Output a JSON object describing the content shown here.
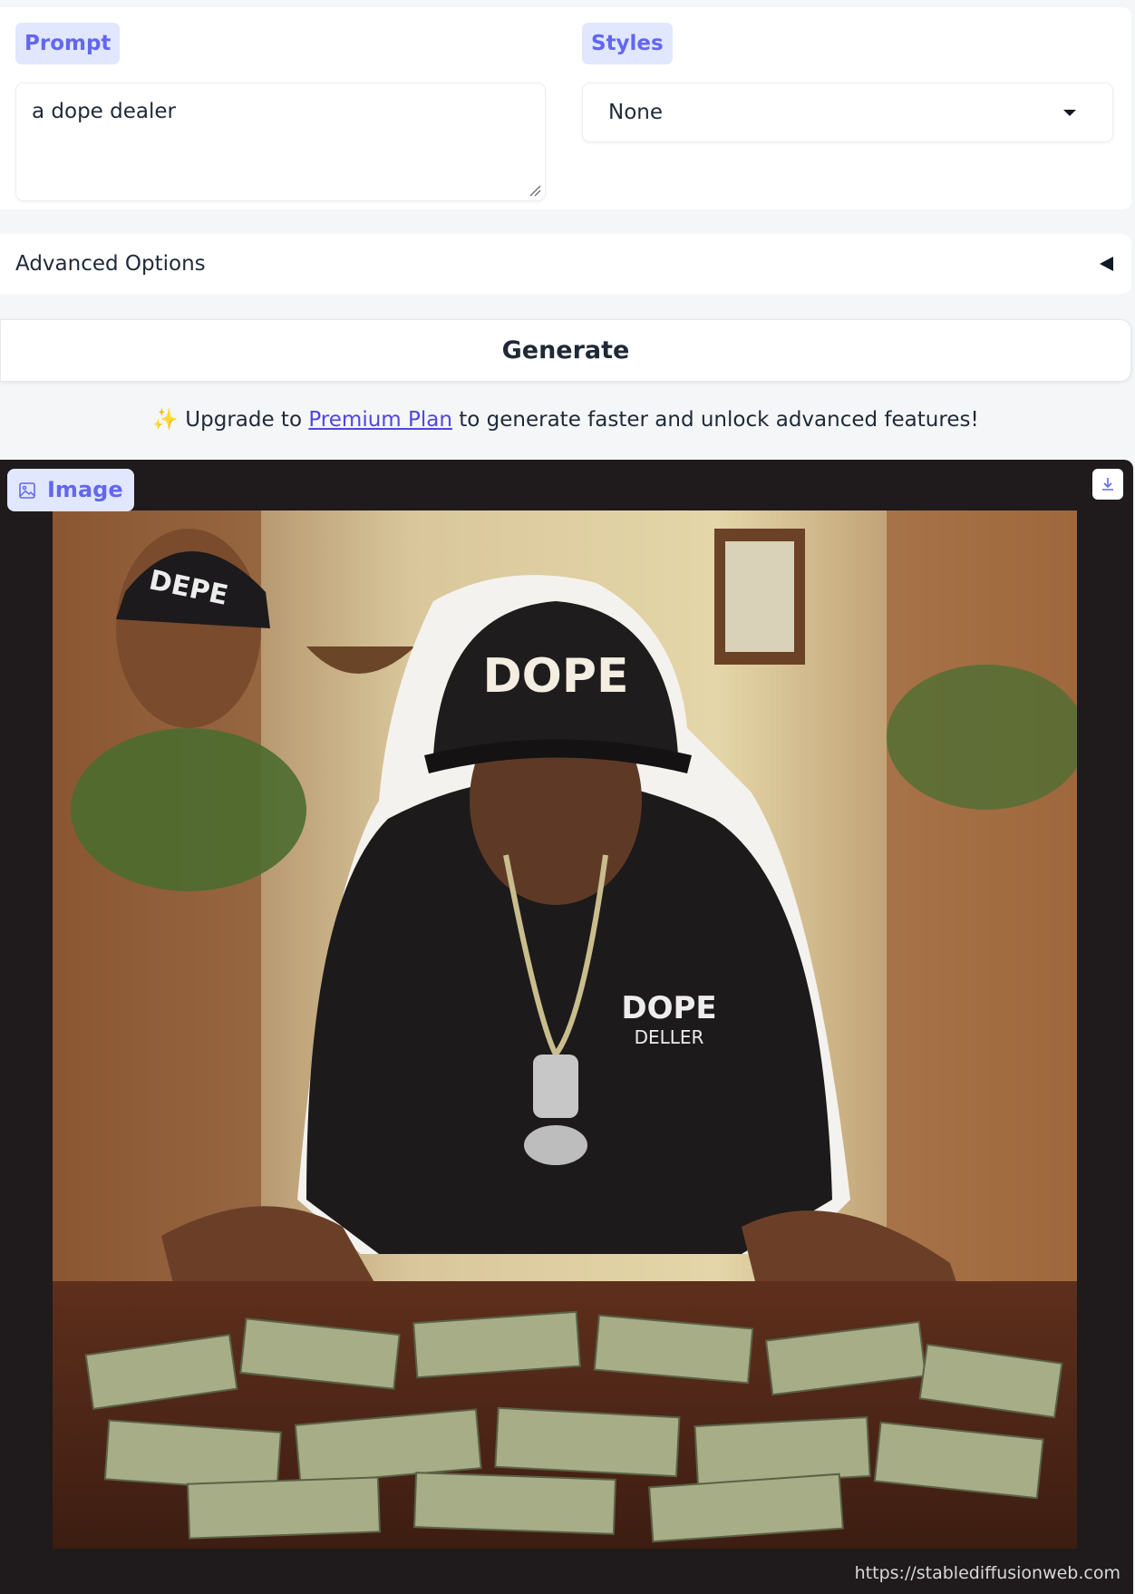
{
  "prompt": {
    "label": "Prompt",
    "value": "a dope dealer"
  },
  "styles": {
    "label": "Styles",
    "selected": "None"
  },
  "advanced_options": {
    "label": "Advanced Options"
  },
  "generate": {
    "label": "Generate"
  },
  "upgrade": {
    "emoji": "✨",
    "prefix": "Upgrade to",
    "link_text": "Premium Plan",
    "suffix": "to generate faster and unlock advanced features!"
  },
  "output": {
    "label": "Image",
    "image_hat_text": "DOPE",
    "image_background_hat_text": "DEPE",
    "image_shirt_text_line1": "DOPE",
    "image_shirt_text_line2": "DELLER",
    "watermark": "https://stablediffusionweb.com"
  },
  "colors": {
    "accent": "#6366f1",
    "pill_bg": "#e0e7ff",
    "link": "#4f46e5",
    "image_frame": "#1f1a1b"
  },
  "icons": {
    "image_label_icon": "image-icon",
    "download": "download-icon",
    "dropdown": "chevron-down-icon",
    "collapse": "caret-left-icon",
    "resize": "resize-handle-icon"
  }
}
